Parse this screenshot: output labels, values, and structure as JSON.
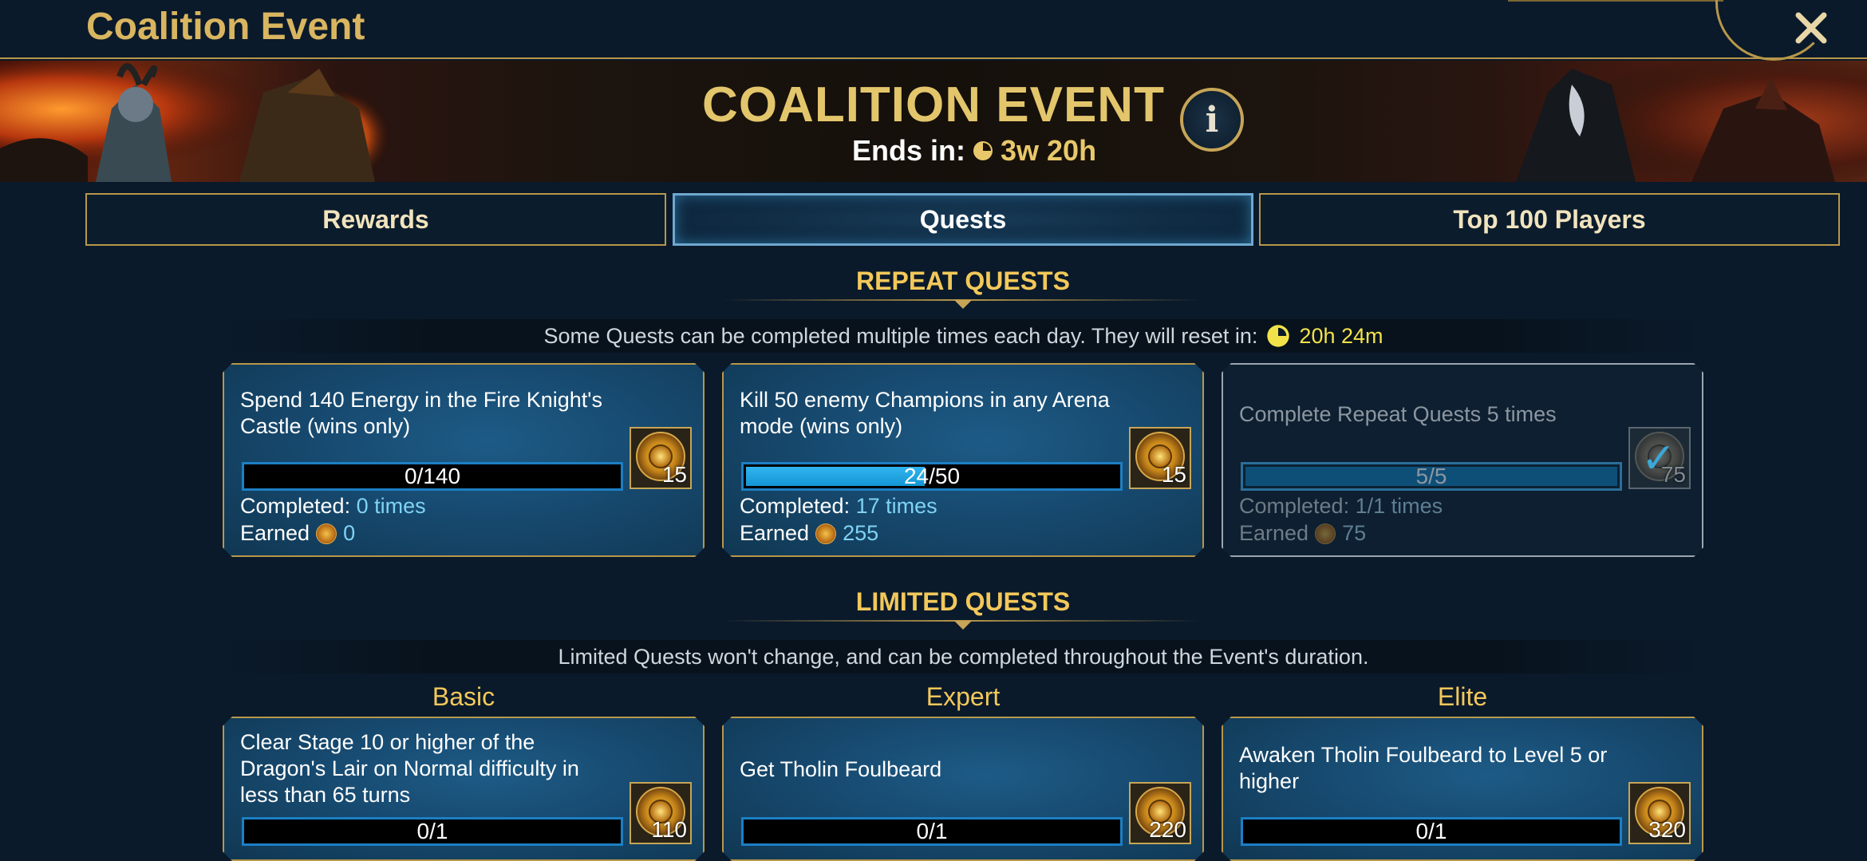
{
  "window": {
    "title": "Coalition Event",
    "close_glyph": "✕"
  },
  "banner": {
    "title": "COALITION EVENT",
    "ends_label": "Ends in:",
    "ends_time": "3w 20h",
    "info_glyph": "i"
  },
  "tabs": [
    {
      "label": "Rewards",
      "active": false
    },
    {
      "label": "Quests",
      "active": true
    },
    {
      "label": "Top 100 Players",
      "active": false
    }
  ],
  "repeat_section": {
    "title": "REPEAT QUESTS",
    "info": "Some Quests can be completed multiple times each day. They will reset in:",
    "reset_time": "20h 24m",
    "quests": [
      {
        "text": "Spend 140 Energy in the Fire Knight's Castle (wins only)",
        "progress_text": "0/140",
        "progress": 0.0,
        "reward": "15",
        "completed_label": "Completed:",
        "completed_value": "0 times",
        "earned_label": "Earned",
        "earned_value": "0"
      },
      {
        "text": "Kill 50 enemy Champions in any Arena mode (wins only)",
        "progress_text": "24/50",
        "progress": 0.48,
        "reward": "15",
        "completed_label": "Completed:",
        "completed_value": "17 times",
        "earned_label": "Earned",
        "earned_value": "255"
      },
      {
        "text": "Complete Repeat Quests 5 times",
        "progress_text": "5/5",
        "progress": 1.0,
        "reward": "75",
        "completed_label": "Completed:",
        "completed_value": "1/1 times",
        "earned_label": "Earned",
        "earned_value": "75"
      }
    ]
  },
  "limited_section": {
    "title": "LIMITED QUESTS",
    "info": "Limited Quests won't change, and can be completed throughout the Event's duration.",
    "tiers": [
      "Basic",
      "Expert",
      "Elite"
    ],
    "quests": [
      {
        "text": "Clear Stage 10 or higher of the Dragon's Lair on Normal difficulty in less than 65 turns",
        "progress_text": "0/1",
        "reward": "110"
      },
      {
        "text": "Get Tholin Foulbeard",
        "progress_text": "0/1",
        "reward": "220"
      },
      {
        "text": "Awaken Tholin Foulbeard to Level 5 or higher",
        "progress_text": "0/1",
        "reward": "320"
      }
    ]
  },
  "icons": [
    "close-icon",
    "clock-icon",
    "info-icon",
    "medal-icon",
    "coin-icon",
    "checkmark-icon"
  ],
  "colors": {
    "gold": "#d9b560",
    "accent_yellow": "#f3c85a",
    "progress_blue": "#1c7fc4",
    "card_blue": "#174a70"
  }
}
